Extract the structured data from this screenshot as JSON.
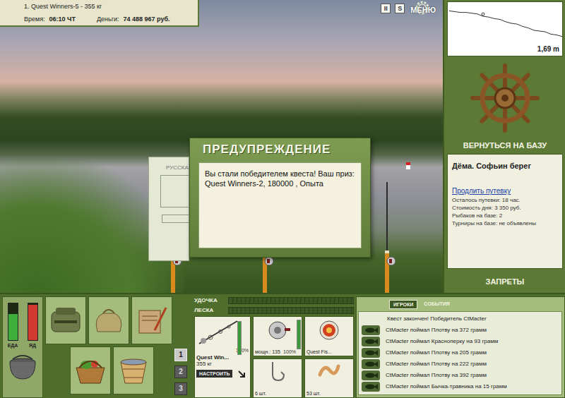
{
  "hud": {
    "quest": "1. Quest Winners-5 - 355 кг",
    "time_label": "Время:",
    "time": "06:10 ЧТ",
    "money_label": "Деньги:",
    "money": "74 488 967 руб."
  },
  "top_buttons": [
    "II",
    "S"
  ],
  "menu": "МЕНЮ",
  "depth": {
    "reading": "1,69 m",
    "values": [
      0.2,
      0.25,
      0.3,
      0.3,
      0.35,
      0.4,
      0.55,
      0.6,
      0.7,
      0.75,
      0.9,
      1.0,
      1.05,
      1.2,
      1.3,
      1.45,
      1.5,
      1.55,
      1.7,
      1.75,
      1.85
    ],
    "marker_index": 6
  },
  "back_panel": {
    "title": "РУССКАЯ"
  },
  "dialog": {
    "title": "ПРЕДУПРЕЖДЕНИЕ",
    "message": "Вы стали победителем квеста! Ваш приз: Quest Winners-2, 180000 , Опыта"
  },
  "base": {
    "return": "ВЕРНУТЬСЯ НА БАЗУ",
    "location": "Дёма. Софьин берег",
    "extend_link": "Продлить путевку",
    "info": [
      "Осталось путевки: 18 час.",
      "Стоимость дня: 3 350 руб.",
      "Рыбаков на базе: 2",
      "Турниры на базе: не объявлены"
    ],
    "bans": "ЗАПРЕТЫ"
  },
  "meters": [
    {
      "label": "ЕДА",
      "level": 0.72,
      "color": "#3fae3a"
    },
    {
      "label": "ЯД",
      "level": 0.96,
      "color": "#d03a30"
    }
  ],
  "slots": [
    {
      "label": "1",
      "selected": true
    },
    {
      "label": "2",
      "selected": false
    },
    {
      "label": "3",
      "selected": false
    }
  ],
  "tackle_bars": [
    {
      "label": "УДОЧКА",
      "level": 0
    },
    {
      "label": "ЛЕСКА",
      "level": 0
    }
  ],
  "tackle": {
    "rod": {
      "name": "Quest Win...",
      "weight": "355 кг",
      "condition": "100%",
      "level": 1.0
    },
    "setup": "НАСТРОИТЬ",
    "reel": {
      "power": "мощн.: 135",
      "condition": "100%",
      "level": 1.0
    },
    "lure": {
      "name": "Quest Fis..."
    },
    "hook": {
      "count": "6 шт."
    },
    "bait": {
      "count": "53 шт."
    }
  },
  "log": {
    "tabs": [
      {
        "label": "ИГРОКИ",
        "selected": true
      },
      {
        "label": "СОБЫТИЯ",
        "selected": false
      }
    ],
    "messages": [
      {
        "kind": "system",
        "text": "Квест закончен! Победитель CtMacter"
      },
      {
        "kind": "catch",
        "text": "CtMacter поймал Плотву на 372 грамм"
      },
      {
        "kind": "catch",
        "text": "CtMacter поймал Красноперку на 93 грамм"
      },
      {
        "kind": "catch",
        "text": "CtMacter поймал Плотву на 205 грамм"
      },
      {
        "kind": "catch",
        "text": "CtMacter поймал Плотву на 222 грамм"
      },
      {
        "kind": "catch",
        "text": "CtMacter поймал Плотву на 392 грамм"
      },
      {
        "kind": "catch",
        "text": "CtMacter поймал Бычка-травника на 15 грамм"
      }
    ]
  }
}
